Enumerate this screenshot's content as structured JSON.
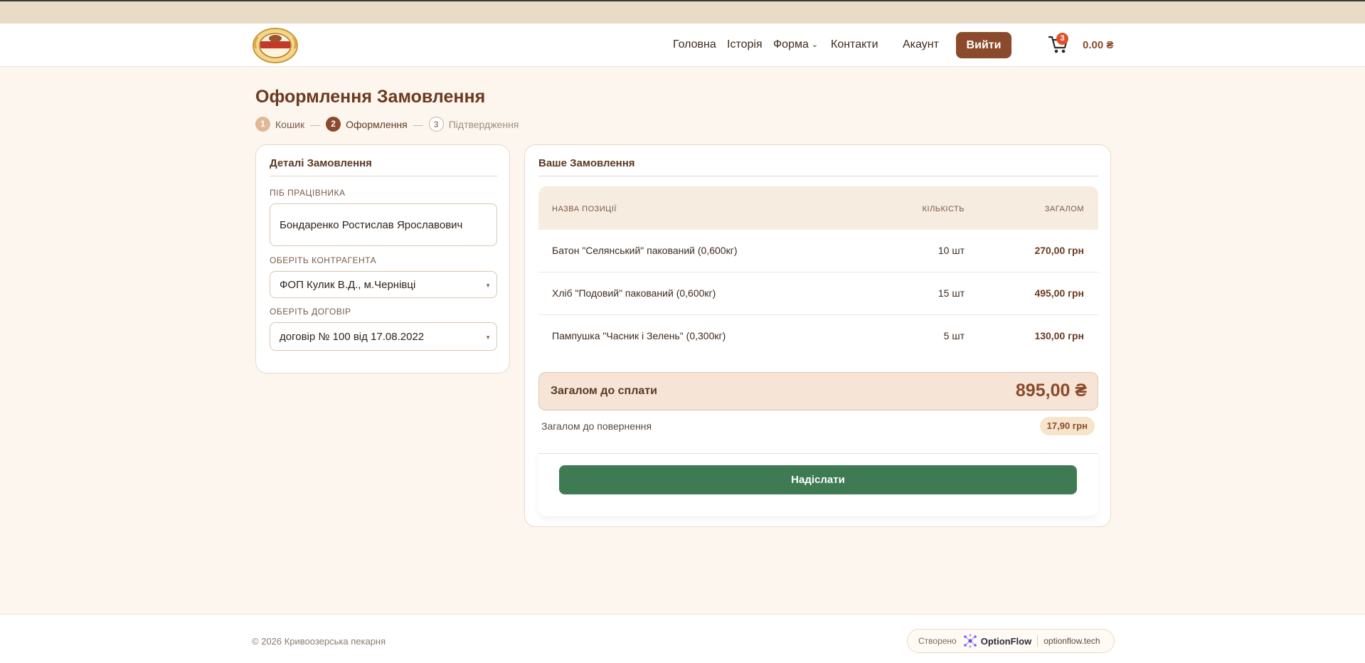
{
  "nav": {
    "items": [
      {
        "label": "Головна"
      },
      {
        "label": "Історія"
      },
      {
        "label": "Форма"
      },
      {
        "label": "Контакти"
      },
      {
        "label": "Акаунт"
      }
    ],
    "logout_label": "Вийти",
    "cart_count": "3",
    "cart_total": "0.00 ₴"
  },
  "page": {
    "title": "Оформлення Замовлення",
    "steps": [
      {
        "num": "1",
        "label": "Кошик"
      },
      {
        "num": "2",
        "label": "Оформлення"
      },
      {
        "num": "3",
        "label": "Підтвердження"
      }
    ]
  },
  "details": {
    "title": "Деталі Замовлення",
    "employee_label": "ПІБ ПРАЦІВНИКА",
    "employee_value": "Бондаренко Ростислав Ярославович",
    "contractor_label": "ОБЕРІТЬ КОНТРАГЕНТА",
    "contractor_value": "ФОП Кулик В.Д., м.Чернівці",
    "contract_label": "ОБЕРІТЬ ДОГОВІР",
    "contract_value": "договір № 100 від 17.08.2022"
  },
  "order": {
    "title": "Ваше Замовлення",
    "columns": {
      "name": "НАЗВА ПОЗИЦІЇ",
      "qty": "КІЛЬКІСТЬ",
      "total": "ЗАГАЛОМ"
    },
    "rows": [
      {
        "name": "Батон \"Селянський\" пакований (0,600кг)",
        "qty": "10 шт",
        "total": "270,00 грн"
      },
      {
        "name": "Хліб \"Подовий\" пакований (0,600кг)",
        "qty": "15 шт",
        "total": "495,00 грн"
      },
      {
        "name": "Пампушка \"Часник і Зелень\" (0,300кг)",
        "qty": "5 шт",
        "total": "130,00 грн"
      }
    ],
    "grand_label": "Загалом до сплати",
    "grand_value": "895,00 ₴",
    "return_label": "Загалом до повернення",
    "return_value": "17,90 грн",
    "submit_label": "Надіслати"
  },
  "footer": {
    "copyright": "© 2026 Кривоозерська пекарня",
    "made_by": "Створено",
    "brand": "OptionFlow",
    "site": "optionflow.tech"
  },
  "colors": {
    "accent": "#8a4a2b",
    "submit": "#3e7a52",
    "badge": "#e0502e",
    "background": "#fdf6ee"
  }
}
